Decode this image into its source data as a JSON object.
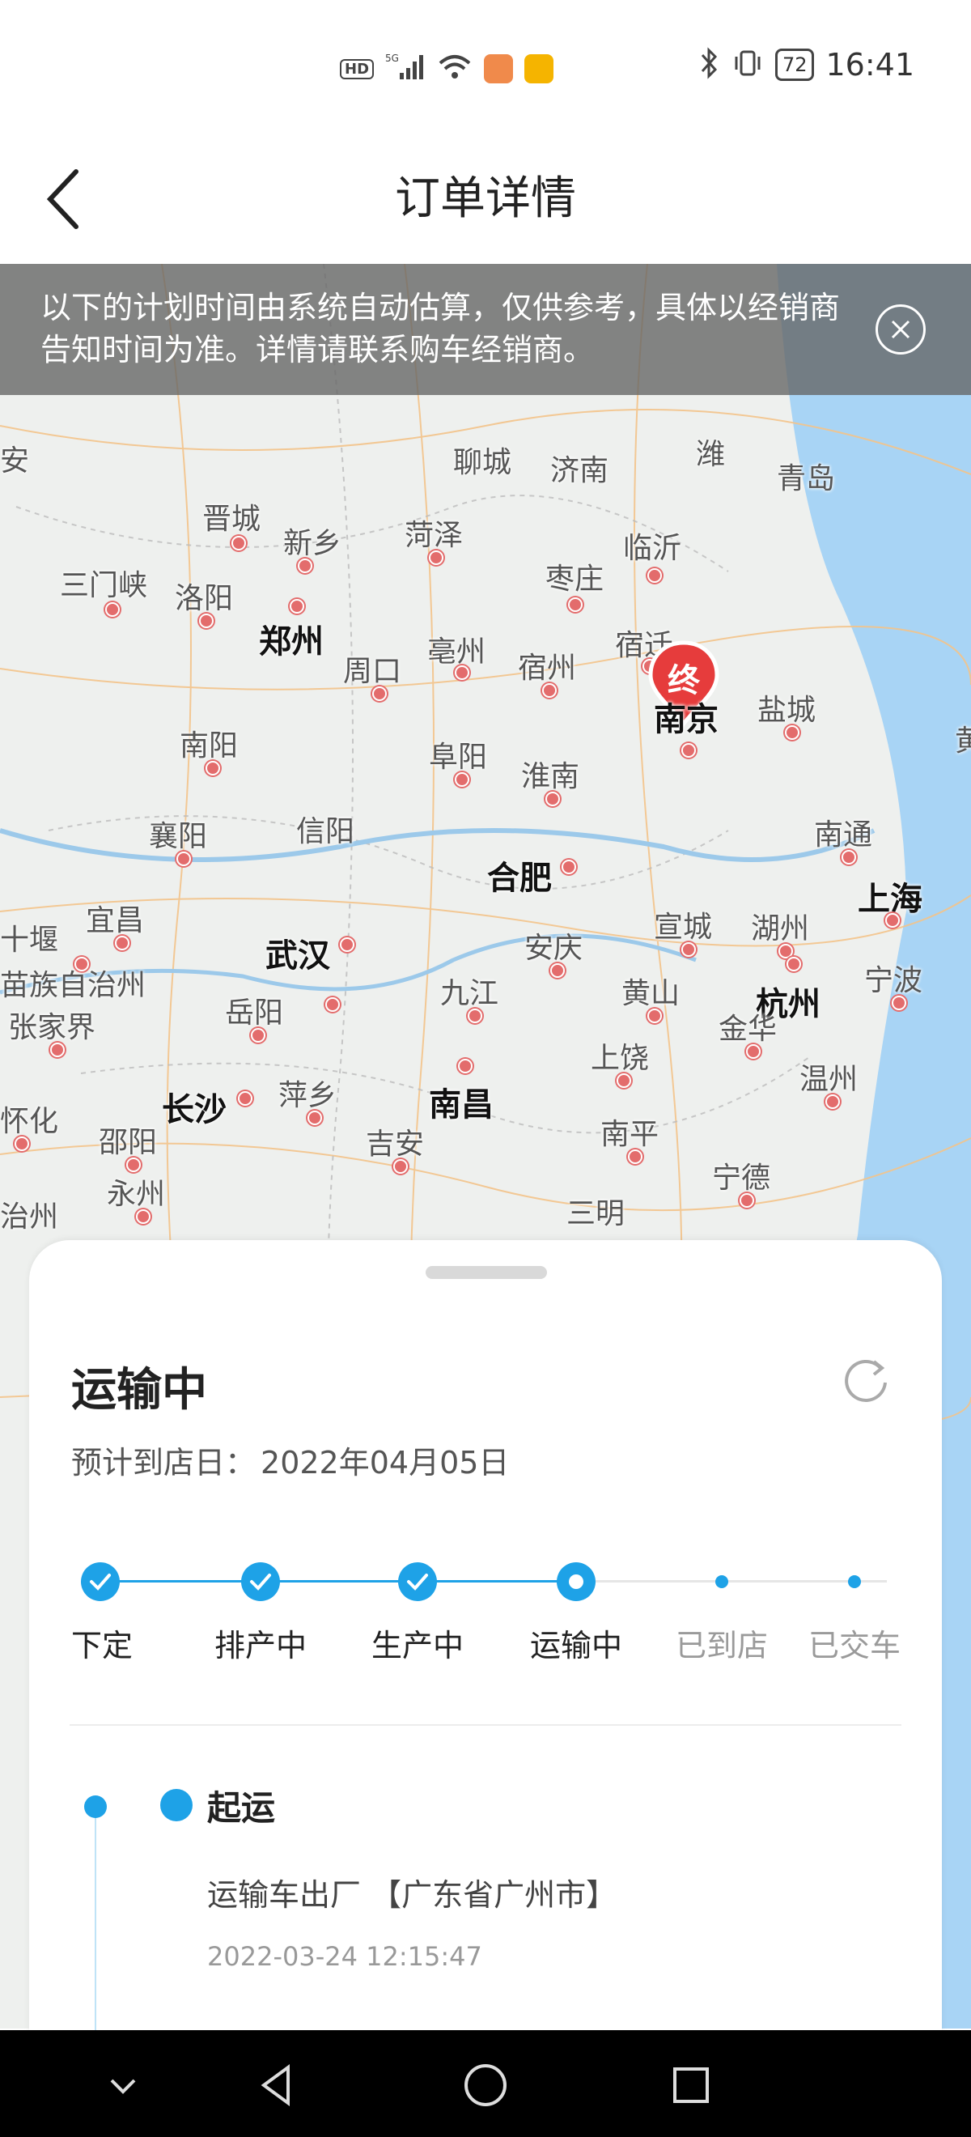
{
  "status_bar": {
    "network_hd": "HD",
    "network_5g": "5G",
    "battery": "72",
    "time": "16:41",
    "icons": [
      "signal-icon",
      "wifi-icon",
      "message-app-icon",
      "notification-app-icon",
      "bluetooth-icon",
      "vibrate-icon",
      "battery-icon"
    ]
  },
  "header": {
    "title": "订单详情",
    "back_icon": "chevron-left-icon"
  },
  "notice": {
    "text": "以下的计划时间由系统自动估算，仅供参考，具体以经销商告知时间为准。详情请联系购车经销商。",
    "close_icon": "close-circle-icon"
  },
  "map": {
    "destination_marker": "终",
    "destination_city": "南京",
    "cities": [
      {
        "name": "安",
        "major": false
      },
      {
        "name": "聊城",
        "major": false
      },
      {
        "name": "济南",
        "major": false
      },
      {
        "name": "潍",
        "major": false
      },
      {
        "name": "青岛",
        "major": false
      },
      {
        "name": "晋城",
        "major": false
      },
      {
        "name": "新乡",
        "major": false
      },
      {
        "name": "菏泽",
        "major": false
      },
      {
        "name": "临沂",
        "major": false
      },
      {
        "name": "三门峡",
        "major": false
      },
      {
        "name": "洛阳",
        "major": false
      },
      {
        "name": "郑州",
        "major": true
      },
      {
        "name": "枣庄",
        "major": false
      },
      {
        "name": "亳州",
        "major": false
      },
      {
        "name": "宿州",
        "major": false
      },
      {
        "name": "宿迁",
        "major": false
      },
      {
        "name": "周口",
        "major": false
      },
      {
        "name": "盐城",
        "major": false
      },
      {
        "name": "南阳",
        "major": false
      },
      {
        "name": "阜阳",
        "major": false
      },
      {
        "name": "十堰",
        "major": false
      },
      {
        "name": "淮南",
        "major": false
      },
      {
        "name": "襄阳",
        "major": false
      },
      {
        "name": "信阳",
        "major": false
      },
      {
        "name": "合肥",
        "major": true
      },
      {
        "name": "南通",
        "major": false
      },
      {
        "name": "上海",
        "major": true
      },
      {
        "name": "宜昌",
        "major": false
      },
      {
        "name": "宣城",
        "major": false
      },
      {
        "name": "湖州",
        "major": false
      },
      {
        "name": "安庆",
        "major": false
      },
      {
        "name": "武汉",
        "major": true
      },
      {
        "name": "苗族自治州",
        "major": false
      },
      {
        "name": "九江",
        "major": false
      },
      {
        "name": "黄山",
        "major": false
      },
      {
        "name": "杭州",
        "major": true
      },
      {
        "name": "宁波",
        "major": false
      },
      {
        "name": "张家界",
        "major": false
      },
      {
        "name": "岳阳",
        "major": false
      },
      {
        "name": "金华",
        "major": false
      },
      {
        "name": "南昌",
        "major": true
      },
      {
        "name": "上饶",
        "major": false
      },
      {
        "name": "长沙",
        "major": true
      },
      {
        "name": "温州",
        "major": false
      },
      {
        "name": "怀化",
        "major": false
      },
      {
        "name": "萍乡",
        "major": false
      },
      {
        "name": "邵阳",
        "major": false
      },
      {
        "name": "吉安",
        "major": false
      },
      {
        "name": "南平",
        "major": false
      },
      {
        "name": "永州",
        "major": false
      },
      {
        "name": "宁德",
        "major": false
      },
      {
        "name": "治州",
        "major": false
      },
      {
        "name": "三明",
        "major": false
      },
      {
        "name": "黄",
        "major": false
      }
    ]
  },
  "sheet": {
    "status_title": "运输中",
    "refresh_icon": "refresh-icon",
    "eta_label": "预计到店日：",
    "eta_value": "2022年04月05日",
    "steps": [
      {
        "label": "下定",
        "state": "done"
      },
      {
        "label": "排产中",
        "state": "done"
      },
      {
        "label": "生产中",
        "state": "done"
      },
      {
        "label": "运输中",
        "state": "current"
      },
      {
        "label": "已到店",
        "state": "pending"
      },
      {
        "label": "已交车",
        "state": "pending"
      }
    ],
    "timeline": [
      {
        "title": "起运",
        "desc": "运输车出厂 【广东省广州市】",
        "time": "2022-03-24 12:15:47"
      }
    ]
  },
  "navbar": {
    "icons": [
      "hide-keyboard-icon",
      "back-triangle-icon",
      "home-circle-icon",
      "recent-square-icon"
    ]
  },
  "colors": {
    "accent": "#1ea2e7",
    "marker": "#e63c3c",
    "notice_bg": "#646464"
  }
}
